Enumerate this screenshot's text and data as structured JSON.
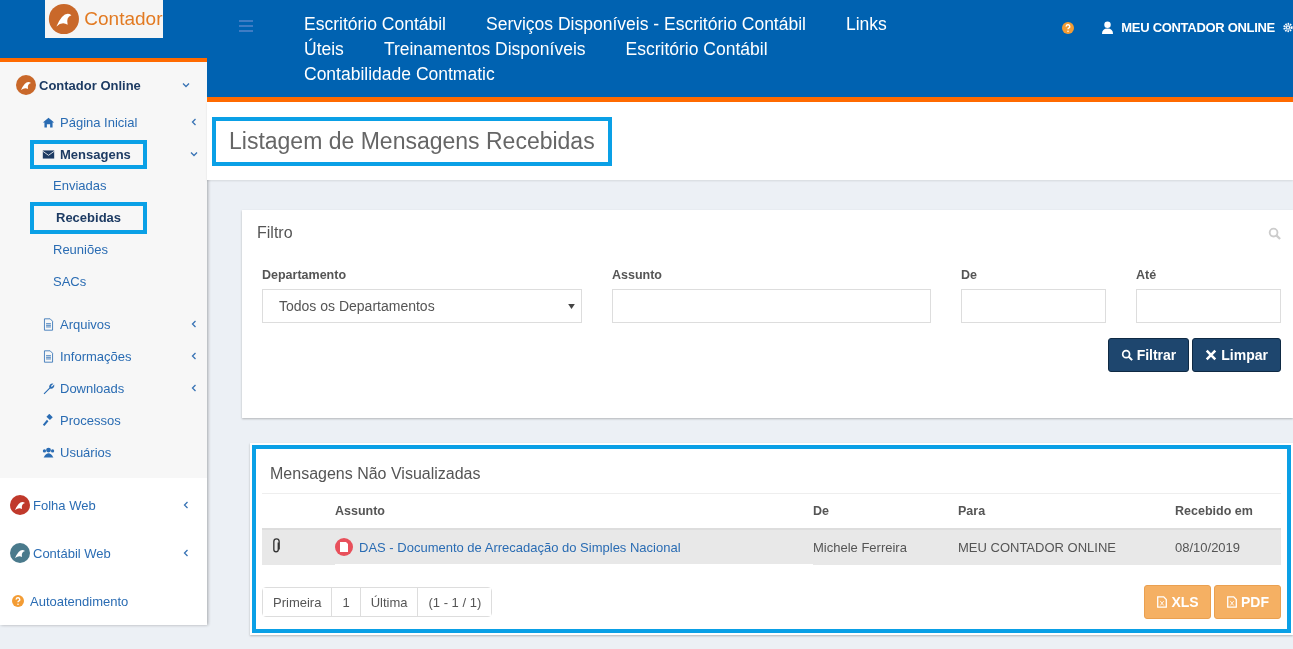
{
  "brand": {
    "name": "Contador"
  },
  "topnav": {
    "links": [
      "Escritório Contábil",
      "Serviços Disponíveis - Escritório Contábil",
      "Links",
      "Úteis",
      "Treinamentos Disponíveis",
      "Escritório Contábil",
      "Contabilidade Contmatic"
    ],
    "user": "MEU CONTADOR ONLINE"
  },
  "sidebar": {
    "groups": [
      {
        "label": "Contador Online",
        "expanded": true,
        "children": [
          {
            "label": "Página Inicial",
            "expanded": false,
            "highlighted": false
          },
          {
            "label": "Mensagens",
            "expanded": true,
            "highlighted": true,
            "children": [
              {
                "label": "Enviadas",
                "selected": false,
                "highlighted": false
              },
              {
                "label": "Recebidas",
                "selected": true,
                "highlighted": true
              },
              {
                "label": "Reuniões",
                "selected": false,
                "highlighted": false
              },
              {
                "label": "SACs",
                "selected": false,
                "highlighted": false
              }
            ]
          },
          {
            "label": "Arquivos",
            "expanded": false,
            "highlighted": false
          },
          {
            "label": "Informações",
            "expanded": false,
            "highlighted": false
          },
          {
            "label": "Downloads",
            "expanded": false,
            "highlighted": false
          },
          {
            "label": "Processos",
            "highlighted": false
          },
          {
            "label": "Usuários",
            "highlighted": false
          }
        ]
      },
      {
        "label": "Folha Web",
        "expanded": false
      },
      {
        "label": "Contábil Web",
        "expanded": false
      }
    ],
    "help": "Autoatendimento"
  },
  "page_title": {
    "text": "Listagem de Mensagens Recebidas",
    "highlighted": true
  },
  "filter": {
    "title": "Filtro",
    "fields": [
      {
        "kind": "select",
        "label": "Departamento",
        "value": "Todos os Departamentos"
      },
      {
        "kind": "text",
        "label": "Assunto"
      },
      {
        "kind": "text",
        "label": "De"
      },
      {
        "kind": "text",
        "label": "Até"
      }
    ],
    "buttons": [
      "Filtrar",
      "Limpar"
    ]
  },
  "messages": {
    "title": "Mensagens Não Visualizadas",
    "highlighted": true,
    "columns": [
      "Assunto",
      "De",
      "Para",
      "Recebido em"
    ],
    "rows": [
      {
        "attachment": true,
        "subject": "DAS - Documento de Arrecadação do Simples Nacional",
        "from": "Michele Ferreira",
        "to": "MEU CONTADOR ONLINE",
        "received": "08/10/2019"
      }
    ],
    "pagination": [
      "Primeira",
      "1",
      "Última",
      "(1 - 1 / 1)"
    ],
    "exports": [
      "XLS",
      "PDF"
    ]
  }
}
